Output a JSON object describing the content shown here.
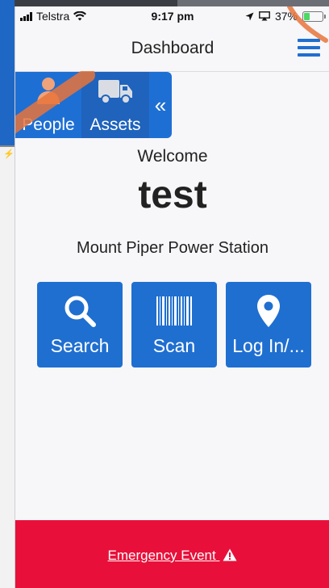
{
  "status_bar": {
    "carrier": "Telstra",
    "time": "9:17 pm",
    "battery": "37%",
    "battery_level": 0.37,
    "battery_color": "#4cd964"
  },
  "navbar": {
    "title": "Dashboard",
    "menu_icon": "hamburger-menu-icon",
    "accent": "#1f6fd0"
  },
  "side_tabs": {
    "items": [
      {
        "label": "People",
        "icon": "person-icon"
      },
      {
        "label": "Assets",
        "icon": "truck-icon"
      }
    ],
    "collapse_glyph": "«"
  },
  "main": {
    "welcome": "Welcome",
    "username": "test",
    "site": "Mount Piper Power Station"
  },
  "actions": [
    {
      "label": "Search",
      "icon": "search-icon"
    },
    {
      "label": "Scan",
      "icon": "barcode-icon"
    },
    {
      "label": "Log In/...",
      "icon": "location-pin-icon"
    }
  ],
  "footer": {
    "emergency_label": "Emergency Event",
    "icon": "warning-icon",
    "color": "#e8103a"
  }
}
